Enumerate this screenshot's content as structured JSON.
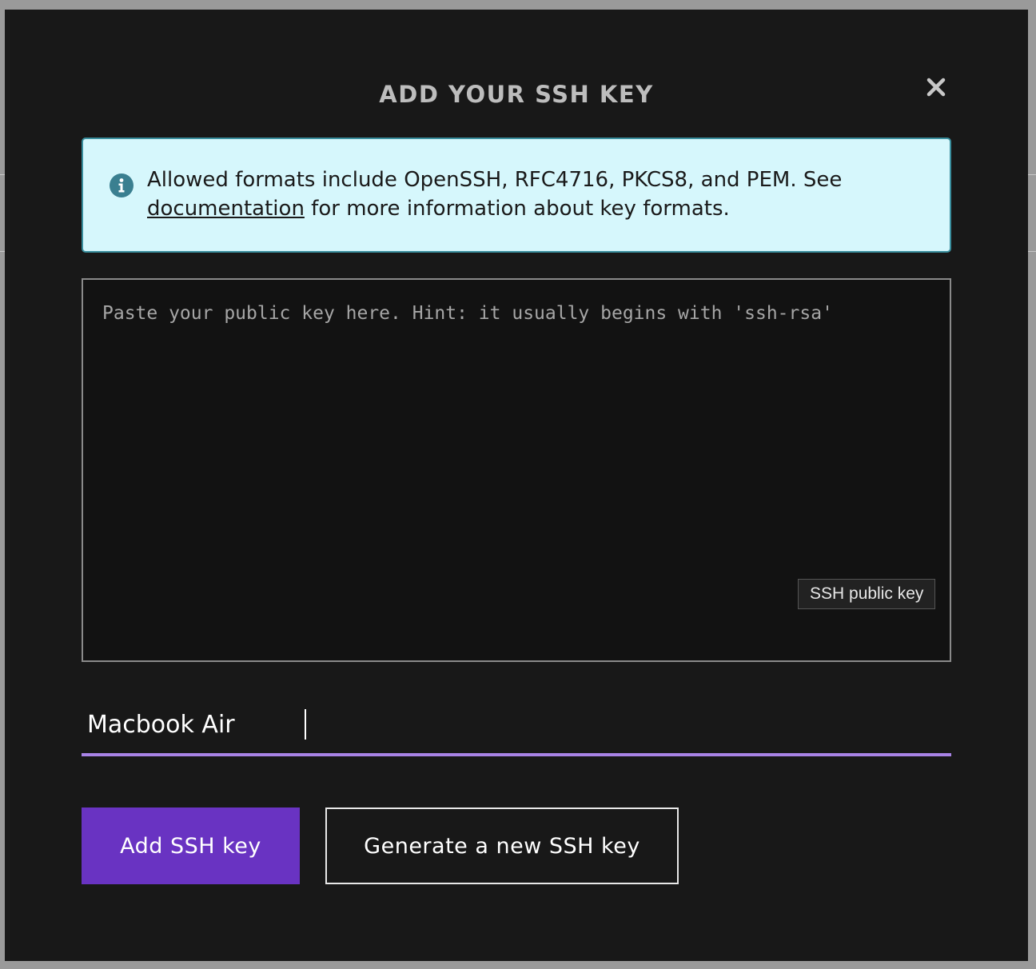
{
  "modal": {
    "title": "ADD YOUR SSH KEY",
    "close_icon": "close-icon"
  },
  "info": {
    "icon": "info-icon",
    "text_before": "Allowed formats include OpenSSH, RFC4716, PKCS8, and PEM. See ",
    "link_text": "documentation",
    "text_after": " for more information about key formats."
  },
  "key_input": {
    "placeholder": "Paste your public key here. Hint: it usually begins with 'ssh-rsa'",
    "value": "",
    "tooltip": "SSH public key"
  },
  "name_input": {
    "value": "Macbook Air"
  },
  "actions": {
    "primary_label": "Add SSH key",
    "secondary_label": "Generate a new SSH key"
  },
  "colors": {
    "modal_bg": "#181818",
    "info_bg": "#d6f7fc",
    "info_border": "#3a8f9e",
    "accent": "#6933c2",
    "underline": "#a883e6"
  }
}
